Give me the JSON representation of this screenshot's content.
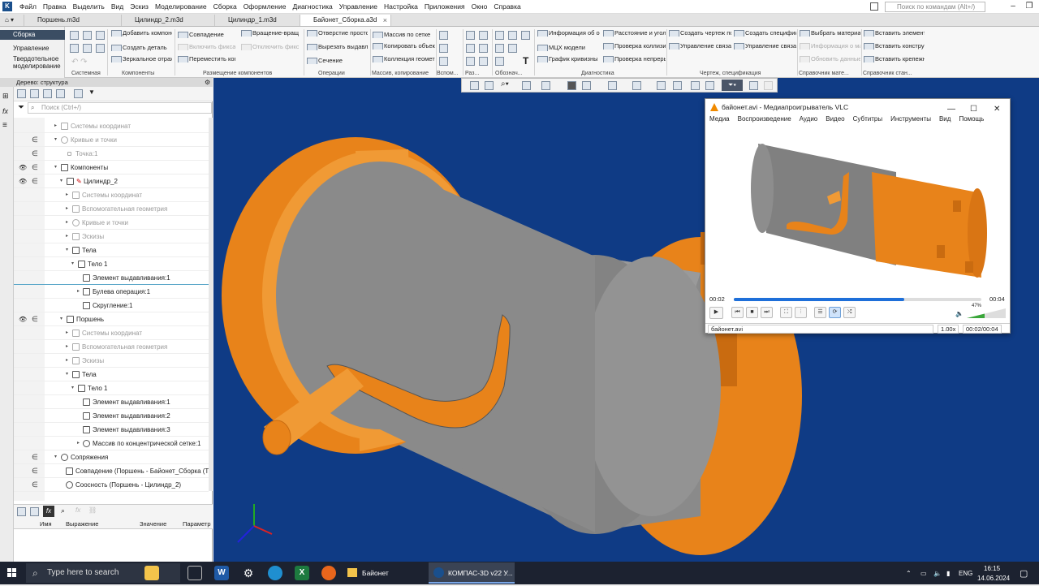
{
  "menubar": {
    "items": [
      "Файл",
      "Правка",
      "Выделить",
      "Вид",
      "Эскиз",
      "Моделирование",
      "Сборка",
      "Оформление",
      "Диагностика",
      "Управление",
      "Настройка",
      "Приложения",
      "Окно",
      "Справка"
    ],
    "search_placeholder": "Поиск по командам (Alt+/)"
  },
  "tabs": [
    {
      "label": "Поршень.m3d"
    },
    {
      "label": "Цилиндр_2.m3d"
    },
    {
      "label": "Цилиндр_1.m3d"
    },
    {
      "label": "Байонет_Сборка.a3d"
    }
  ],
  "modes": [
    "Сборка",
    "Управление",
    "Твердотельное моделирование"
  ],
  "ribbon": {
    "commands": {
      "add_component": "Добавить компонент из...",
      "create_part": "Создать деталь",
      "mirror": "Зеркальное отражение ко...",
      "coincidence": "Совпадение",
      "enable_fix": "Включить фиксацию",
      "move_component": "Переместить компонент",
      "rotation": "Вращение-вращение",
      "disable_fix": "Отключить фиксацию",
      "hole": "Отверстие простое",
      "cut_extrude": "Вырезать выдавливанием",
      "section": "Сечение",
      "grid_array": "Массив по сетке",
      "copy_objects": "Копировать объекты",
      "geometry_collection": "Коллекция геометрии",
      "object_info": "Информация об объекте",
      "mcx_model": "МЦХ модели",
      "curvature_graph": "График кривизны",
      "distance_angle": "Расстояние и угол",
      "collision_check": "Проверка коллизий",
      "continuity_check": "Проверка непрерывности",
      "drawing_template": "Создать чертеж по шаблону",
      "linked_drawings": "Управление связанными ч...",
      "create_spec": "Создать спецификацию",
      "linked_specs": "Управление связанными с...",
      "choose_material": "Выбрать материал...",
      "material_info": "Информация о матер...",
      "update_material_data": "Обновить данные по мат...",
      "insert_element": "Вставить элемент",
      "insert_constructive": "Вставить конструктивн...",
      "insert_fastener": "Вставить крепежное со..."
    },
    "groups": {
      "system": "Системная",
      "components": "Компоненты",
      "placement": "Размещение компонентов",
      "operations": "Операции",
      "arrays": "Массив, копирование",
      "auxiliary": "Вспом...",
      "sizes": "Раз...",
      "notation": "Обознач...",
      "diagnostics": "Диагностика",
      "drawing_spec": "Чертеж, спецификация",
      "material_ref": "Справочник мате...",
      "standard_ref": "Справочник стан..."
    }
  },
  "tree": {
    "title": "Дерево: структура",
    "search_placeholder": "Поиск (Ctrl+/)",
    "rows": [
      {
        "label": "Системы координат"
      },
      {
        "label": "Кривые и точки"
      },
      {
        "label": "Точка:1"
      },
      {
        "label": "Компоненты"
      },
      {
        "label": "Цилиндр_2"
      },
      {
        "label": "Системы координат"
      },
      {
        "label": "Вспомогательная геометрия"
      },
      {
        "label": "Кривые и точки"
      },
      {
        "label": "Эскизы"
      },
      {
        "label": "Тела"
      },
      {
        "label": "Тело 1"
      },
      {
        "label": "Элемент выдавливания:1"
      },
      {
        "label": "Булева операция:1"
      },
      {
        "label": "Скругление:1"
      },
      {
        "label": "Поршень"
      },
      {
        "label": "Системы координат"
      },
      {
        "label": "Вспомогательная геометрия"
      },
      {
        "label": "Эскизы"
      },
      {
        "label": "Тела"
      },
      {
        "label": "Тело 1"
      },
      {
        "label": "Элемент выдавливания:1"
      },
      {
        "label": "Элемент выдавливания:2"
      },
      {
        "label": "Элемент выдавливания:3"
      },
      {
        "label": "Массив по концентрической сетке:1"
      },
      {
        "label": "Сопряжения"
      },
      {
        "label": "Совпадение (Поршень - Байонет_Сборка (Т"
      },
      {
        "label": "Соосность (Поршень - Цилиндр_2)"
      }
    ]
  },
  "variables": {
    "columns": [
      "Имя",
      "Выражение",
      "Значение",
      "Параметр"
    ]
  },
  "vlc": {
    "title": "байонет.avi - Медиапроигрыватель VLC",
    "menu": [
      "Медиа",
      "Воспроизведение",
      "Аудио",
      "Видео",
      "Субтитры",
      "Инструменты",
      "Вид",
      "Помощь"
    ],
    "elapsed": "00:02",
    "total": "00:04",
    "progress": 0.69,
    "volume": "47%",
    "filename": "байонет.avi",
    "speed": "1.00x",
    "time_status": "00:02/00:04"
  },
  "taskbar": {
    "search_placeholder": "Type here to search",
    "apps": [
      "Байонет",
      "КОМПАС-3D v22 У..."
    ],
    "lang": "ENG",
    "time": "16:15",
    "date": "14.06.2024"
  },
  "colors": {
    "viewport_bg": "#0f3b85",
    "cylinder_gray": "#8a8a8a",
    "piston_orange": "#f0901e",
    "vlc_progress": "#1e6fd9"
  }
}
